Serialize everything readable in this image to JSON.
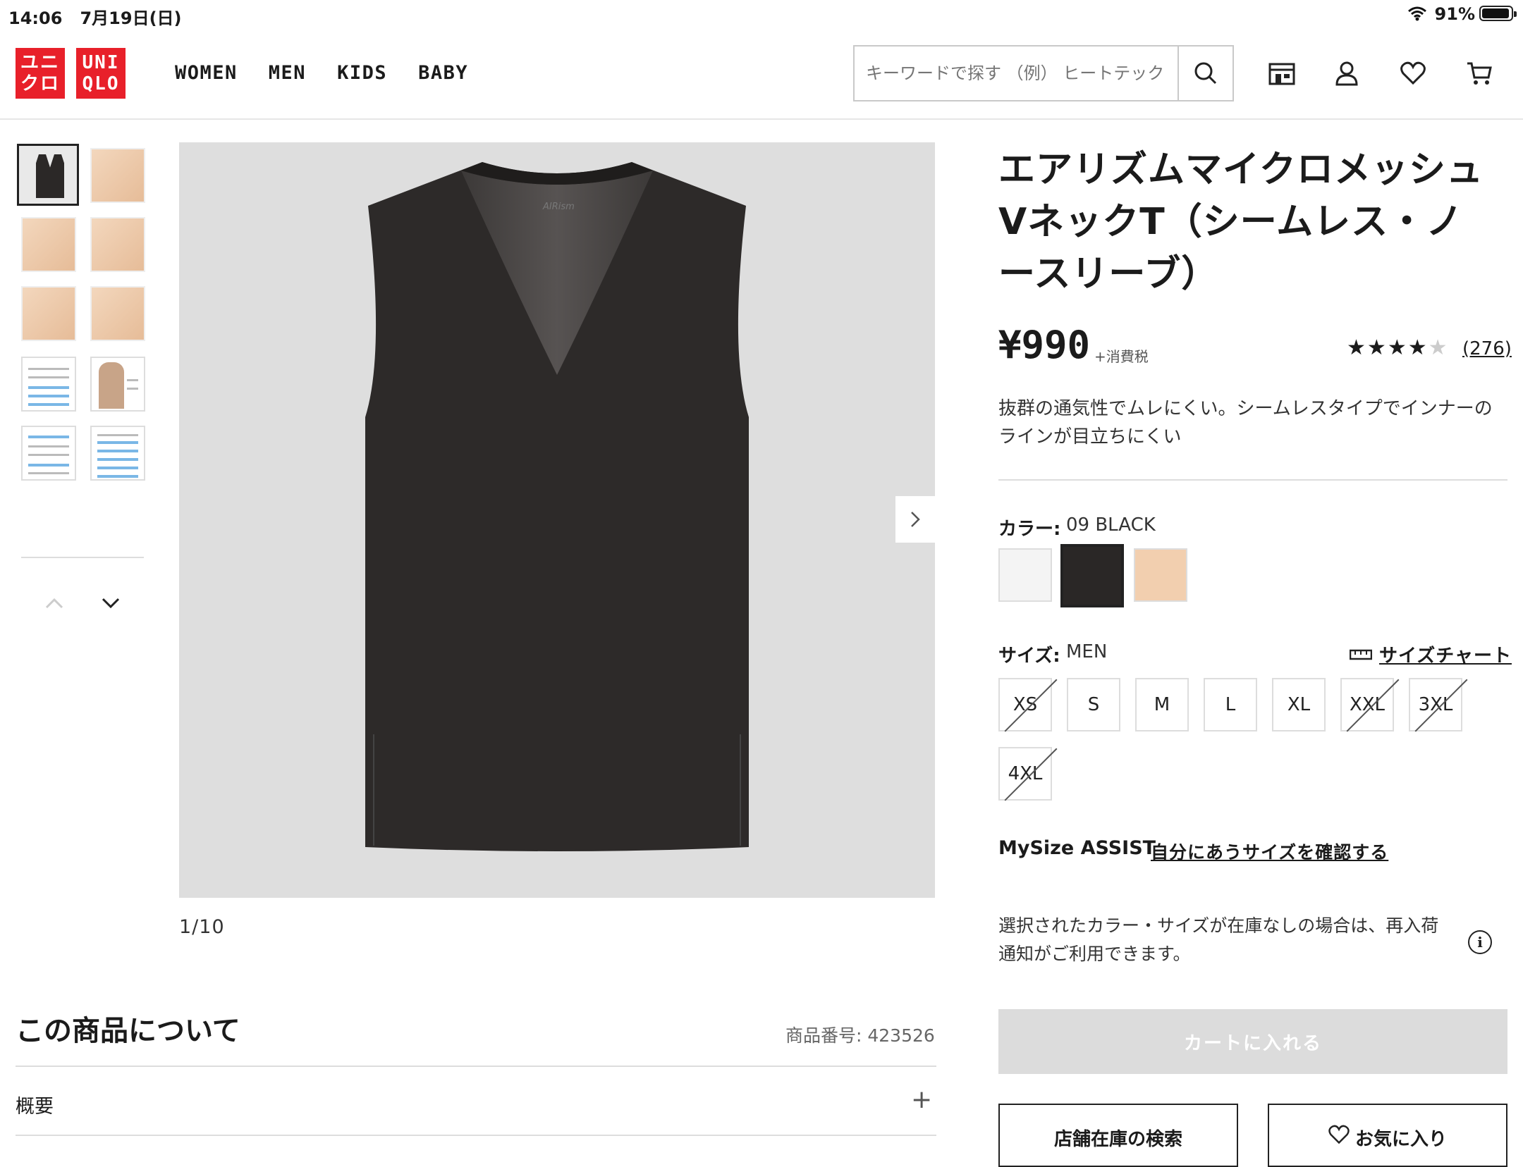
{
  "status_bar": {
    "time": "14:06",
    "date": "7月19日(日)",
    "battery": "91%"
  },
  "header": {
    "logo": {
      "top_left": "ユニ",
      "bottom_left": "クロ",
      "top_right": "UNI",
      "bottom_right": "QLO"
    },
    "nav": [
      "WOMEN",
      "MEN",
      "KIDS",
      "BABY"
    ],
    "search_placeholder": "キーワードで探す （例） ヒートテック"
  },
  "gallery": {
    "counter": "1/10",
    "watermark": "AIRism"
  },
  "product": {
    "title": "エアリズムマイクロメッシュVネックT（シームレス・ノースリーブ）",
    "price": "¥990",
    "tax_note": "+消費税",
    "rating_stars": 4,
    "reviews": "(276)",
    "description": "抜群の通気性でムレにくい。シームレスタイプでインナーのラインが目立ちにくい",
    "color_label": "カラー:",
    "color_value": "09 BLACK",
    "colors": [
      "#f4f4f4",
      "#2a2726",
      "#f2cfaf"
    ],
    "size_label": "サイズ:",
    "size_value": "MEN",
    "size_chart": "サイズチャート",
    "sizes": [
      {
        "label": "XS",
        "available": false
      },
      {
        "label": "S",
        "available": true
      },
      {
        "label": "M",
        "available": true
      },
      {
        "label": "L",
        "available": true
      },
      {
        "label": "XL",
        "available": true
      },
      {
        "label": "XXL",
        "available": false
      },
      {
        "label": "3XL",
        "available": false
      },
      {
        "label": "4XL",
        "available": false
      }
    ],
    "mysize_label": "MySize ASSIST",
    "mysize_link": "自分にあうサイズを確認する",
    "notice": "選択されたカラー・サイズが在庫なしの場合は、再入荷通知がご利用できます。",
    "add_to_cart": "カートに入れる",
    "store_search": "店舗在庫の検索",
    "favorite": "お気に入り"
  },
  "about": {
    "title": "この商品について",
    "product_no": "商品番号: 423526",
    "overview": "概要"
  },
  "colors": {
    "brand": "#e8202a",
    "disabled": "#dcdcdc"
  }
}
